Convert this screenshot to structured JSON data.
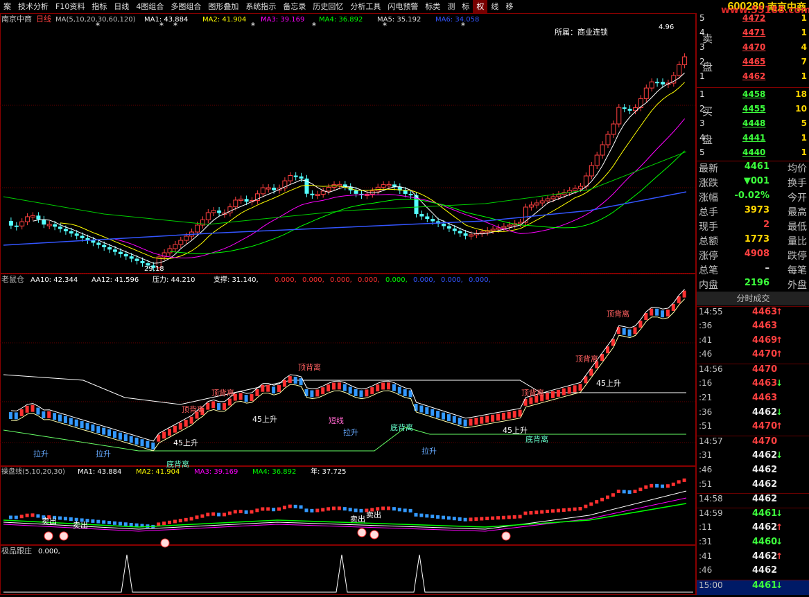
{
  "toolbar": {
    "items": [
      "案",
      "技术分析",
      "F10资料",
      "指标",
      "日线",
      "4图组合",
      "多图组合",
      "图形叠加",
      "系统指示",
      "备忘录",
      "历史回忆",
      "分析工具",
      "闪电预警",
      "标类",
      "测",
      "标",
      "权",
      "线",
      "移"
    ]
  },
  "stock": {
    "code": "600280",
    "name": "南京中商",
    "watermark": "www.55188.com"
  },
  "main_panel": {
    "legend_prefix": "南京中商",
    "legend_period": "日线",
    "legend_ma": "MA(5,10,20,30,60,120)",
    "ma_values": [
      {
        "label": "MA1: 43.884",
        "color": "#ffffff"
      },
      {
        "label": "MA2: 41.904",
        "color": "#ffff00"
      },
      {
        "label": "MA3: 39.169",
        "color": "#ff00ff"
      },
      {
        "label": "MA4: 36.892",
        "color": "#00ff00"
      },
      {
        "label": "MA5: 35.192",
        "color": "#e0e0e0"
      },
      {
        "label": "MA6: 34.058",
        "color": "#3355ff"
      }
    ],
    "sector": "所属：商业连锁",
    "low_label": "29.18",
    "high_label": "4.96"
  },
  "mid_panel": {
    "legend_name": "老鼠仓",
    "legend": [
      {
        "label": "AA10: 42.344",
        "color": "#ffffff"
      },
      {
        "label": "AA12: 41.596",
        "color": "#ffffff"
      },
      {
        "label": "压力: 44.210",
        "color": "#ffffff"
      },
      {
        "label": "支撑: 31.140,",
        "color": "#ffffff"
      },
      {
        "label": "0.000,",
        "color": "#ff3030"
      },
      {
        "label": "0.000,",
        "color": "#ff3030"
      },
      {
        "label": "0.000,",
        "color": "#ff3030"
      },
      {
        "label": "0.000,",
        "color": "#ff3030"
      },
      {
        "label": "0.000,",
        "color": "#00ff00"
      },
      {
        "label": "0.000,",
        "color": "#3355ff"
      },
      {
        "label": "0.000,",
        "color": "#3355ff"
      },
      {
        "label": "0.000,",
        "color": "#3355ff"
      }
    ],
    "labels": [
      "顶背离",
      "顶背离",
      "顶背离",
      "顶背离",
      "顶背离",
      "顶背离",
      "45上升",
      "45上升",
      "45上升",
      "45上升",
      "拉升",
      "拉升",
      "拉升",
      "拉升",
      "短线",
      "底背离",
      "底背离",
      "底背离"
    ]
  },
  "lower_panel": {
    "legend_name": "操盘线(5,10,20,30)",
    "legend": [
      {
        "label": "MA1: 43.884",
        "color": "#ffffff"
      },
      {
        "label": "MA2: 41.904",
        "color": "#ffff00"
      },
      {
        "label": "MA3: 39.169",
        "color": "#ff00ff"
      },
      {
        "label": "MA4: 36.892",
        "color": "#00ff00"
      },
      {
        "label": "年: 37.725",
        "color": "#ffffff"
      }
    ],
    "labels": [
      "卖出",
      "卖出",
      "卖出",
      "卖出"
    ]
  },
  "bottom_panel": {
    "legend_name": "极品跟庄",
    "value": "0.000,"
  },
  "order_book": {
    "sell_label": [
      "卖",
      "盘"
    ],
    "buy_label": [
      "买",
      "盘"
    ],
    "sells": [
      {
        "level": "5",
        "price": "4472",
        "vol": "1"
      },
      {
        "level": "4",
        "price": "4471",
        "vol": "1"
      },
      {
        "level": "3",
        "price": "4470",
        "vol": "4"
      },
      {
        "level": "2",
        "price": "4465",
        "vol": "7"
      },
      {
        "level": "1",
        "price": "4462",
        "vol": "1"
      }
    ],
    "buys": [
      {
        "level": "1",
        "price": "4458",
        "vol": "18"
      },
      {
        "level": "2",
        "price": "4455",
        "vol": "10"
      },
      {
        "level": "3",
        "price": "4448",
        "vol": "5"
      },
      {
        "level": "4",
        "price": "4441",
        "vol": "1"
      },
      {
        "level": "5",
        "price": "4440",
        "vol": "1"
      }
    ]
  },
  "stats": [
    {
      "k1": "最新",
      "v1": "4461",
      "c": "green",
      "k2": "均价"
    },
    {
      "k1": "涨跌",
      "v1": "▼001",
      "c": "green",
      "k2": "换手"
    },
    {
      "k1": "涨幅",
      "v1": "-0.02%",
      "c": "green",
      "k2": "今开"
    },
    {
      "k1": "总手",
      "v1": "3973",
      "c": "yellow",
      "k2": "最高"
    },
    {
      "k1": "现手",
      "v1": "2",
      "c": "red",
      "k2": "最低"
    },
    {
      "k1": "总额",
      "v1": "1773",
      "c": "yellow",
      "k2": "量比"
    },
    {
      "k1": "涨停",
      "v1": "4908",
      "c": "red",
      "k2": "跌停"
    },
    {
      "k1": "总笔",
      "v1": "–",
      "c": "white",
      "k2": "每笔"
    },
    {
      "k1": "内盘",
      "v1": "2196",
      "c": "green",
      "k2": "外盘"
    }
  ],
  "ticks_header": "分时成交",
  "ticks": [
    {
      "t": "14:55",
      "p": "4463",
      "c": "red",
      "a": "↑"
    },
    {
      "t": ":36",
      "p": "4463",
      "c": "red",
      "a": ""
    },
    {
      "t": ":41",
      "p": "4469",
      "c": "red",
      "a": "↑"
    },
    {
      "t": ":46",
      "p": "4470",
      "c": "red",
      "a": "↑"
    },
    {
      "t": "14:56",
      "p": "4470",
      "c": "red",
      "a": ""
    },
    {
      "t": ":16",
      "p": "4463",
      "c": "red",
      "a": "↓"
    },
    {
      "t": ":21",
      "p": "4463",
      "c": "red",
      "a": ""
    },
    {
      "t": ":36",
      "p": "4462",
      "c": "white",
      "a": "↓"
    },
    {
      "t": ":51",
      "p": "4470",
      "c": "red",
      "a": "↑"
    },
    {
      "t": "14:57",
      "p": "4470",
      "c": "red",
      "a": ""
    },
    {
      "t": ":31",
      "p": "4462",
      "c": "white",
      "a": "↓"
    },
    {
      "t": ":46",
      "p": "4462",
      "c": "white",
      "a": ""
    },
    {
      "t": ":51",
      "p": "4462",
      "c": "white",
      "a": ""
    },
    {
      "t": "14:58",
      "p": "4462",
      "c": "white",
      "a": ""
    },
    {
      "t": "14:59",
      "p": "4461",
      "c": "green",
      "a": "↓"
    },
    {
      "t": ":11",
      "p": "4462",
      "c": "white",
      "a": "↑"
    },
    {
      "t": ":31",
      "p": "4460",
      "c": "green",
      "a": "↓"
    },
    {
      "t": ":41",
      "p": "4462",
      "c": "white",
      "a": "↑"
    },
    {
      "t": ":46",
      "p": "4462",
      "c": "white",
      "a": ""
    },
    {
      "t": "15:00",
      "p": "4461",
      "c": "green",
      "a": "↓"
    }
  ]
}
